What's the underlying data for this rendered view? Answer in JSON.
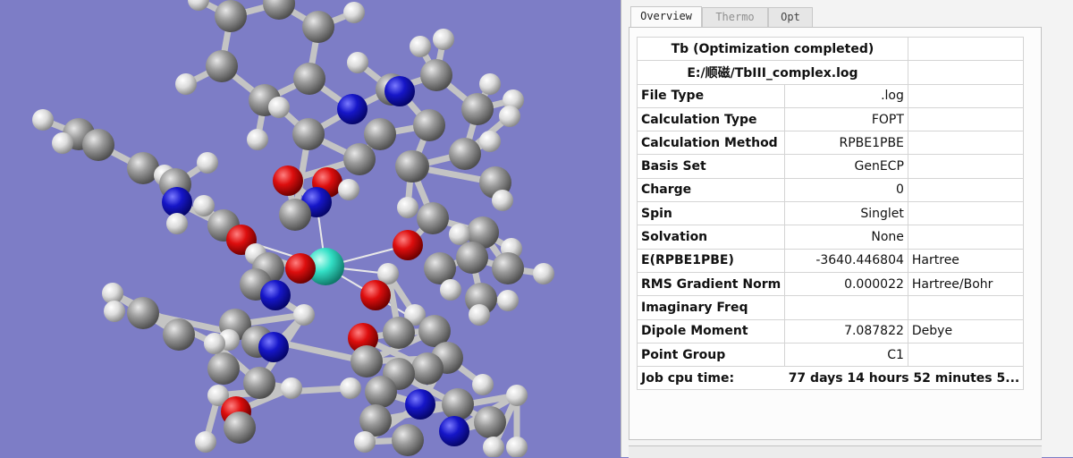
{
  "colors": {
    "background": "#7d7dc6",
    "carbon": "#8f8f8f",
    "hydrogen": "#e2e2e2",
    "nitrogen": "#1414c8",
    "oxygen": "#dd0e0e",
    "terbium": "#33e0c6",
    "bond": "#c4c4c4"
  },
  "tabs": [
    {
      "label": "Overview",
      "active": true
    },
    {
      "label": "Thermo",
      "active": false
    },
    {
      "label": "Opt",
      "active": false
    }
  ],
  "summary": {
    "title": "Tb (Optimization completed)",
    "file": "E:/顺磁/TbIII_complex.log",
    "rows": [
      {
        "label": "File Type",
        "value": ".log",
        "unit": ""
      },
      {
        "label": "Calculation Type",
        "value": "FOPT",
        "unit": ""
      },
      {
        "label": "Calculation Method",
        "value": "RPBE1PBE",
        "unit": ""
      },
      {
        "label": "Basis Set",
        "value": "GenECP",
        "unit": ""
      },
      {
        "label": "Charge",
        "value": "0",
        "unit": ""
      },
      {
        "label": "Spin",
        "value": "Singlet",
        "unit": ""
      },
      {
        "label": "Solvation",
        "value": "None",
        "unit": ""
      },
      {
        "label": "E(RPBE1PBE)",
        "value": "-3640.446804",
        "unit": "Hartree"
      },
      {
        "label": "RMS Gradient Norm",
        "value": "0.000022",
        "unit": "Hartree/Bohr"
      },
      {
        "label": "Imaginary Freq",
        "value": "",
        "unit": ""
      },
      {
        "label": "Dipole Moment",
        "value": "7.087822",
        "unit": "Debye"
      },
      {
        "label": "Point Group",
        "value": "C1",
        "unit": ""
      }
    ],
    "cpu_label": "Job cpu time:",
    "cpu_value": "77 days 14 hours 52 minutes 5..."
  }
}
